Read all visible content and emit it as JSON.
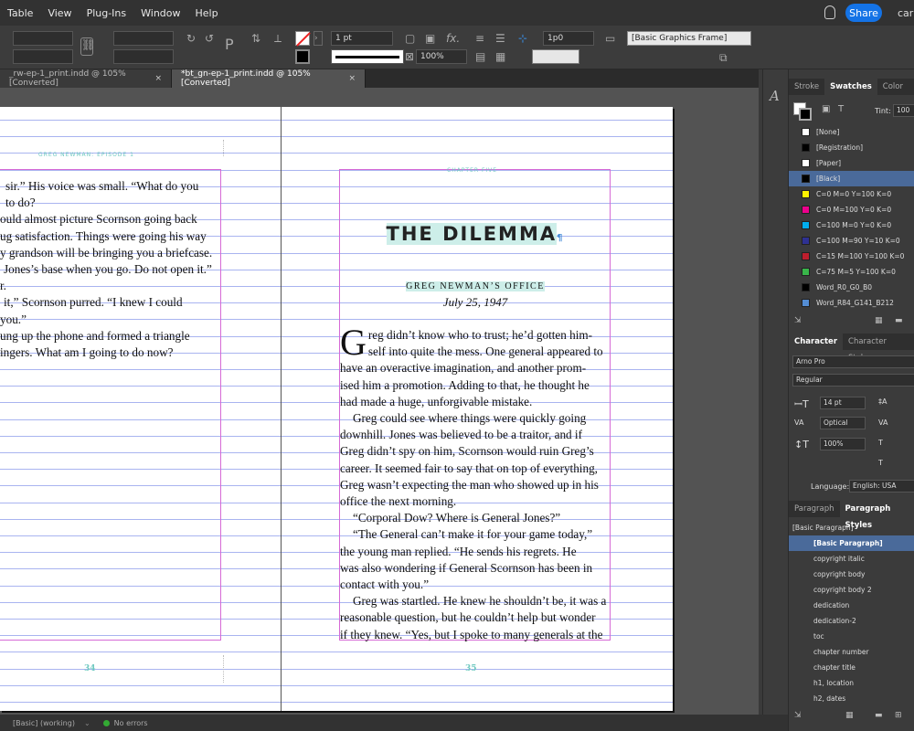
{
  "menu": {
    "items": [
      "Table",
      "View",
      "Plug-Ins",
      "Window",
      "Help"
    ],
    "share": "Share",
    "user": "car"
  },
  "control": {
    "stroke_weight": "1 pt",
    "scale": "100%",
    "offset": "1p0",
    "frame_style": "[Basic Graphics Frame]"
  },
  "tabs": [
    {
      "label": "_rw-ep-1_print.indd @ 105% [Converted]",
      "close": "×"
    },
    {
      "label": "*bt_gn-ep-1_print.indd @ 105% [Converted]",
      "close": "×"
    }
  ],
  "left_page": {
    "running_head": "GREG NEWMAN: EPISODE 1",
    "lines": [
      "sir.” His voice was small. “What do you",
      "to do?",
      "ould almost picture Scornson going back",
      "ug satisfaction. Things were going his way",
      "y grandson will be bringing you a briefcase.",
      "Jones’s base when you go. Do not open it.”",
      "r.",
      "it,” Scornson purred. “I knew I could",
      "you.”",
      "ung up the phone and formed a triangle",
      "ingers. What am I going to do now?"
    ],
    "folio": "34"
  },
  "right_page": {
    "chapter_label": "CHAPTER FIVE",
    "title": "THE DILEMMA",
    "subhead": "GREG NEWMAN’S OFFICE",
    "date": "July 25, 1947",
    "dropcap": "G",
    "lines": [
      "reg didn’t know who to trust; he’d gotten him-",
      "self into quite the mess. One general appeared to",
      "have an overactive imagination, and another prom-",
      "ised him a promotion. Adding to that, he thought he",
      "had made a huge, unforgivable mistake.",
      "Greg could see where things were quickly going",
      "downhill. Jones was believed to be a traitor, and if",
      "Greg didn’t spy on him, Scornson would ruin Greg’s",
      "career. It seemed fair to say that on top of everything,",
      "Greg wasn’t expecting the man who showed up in his",
      "office the next morning.",
      "“Corporal Dow? Where is General Jones?”",
      "“The General can’t make it for your game today,”",
      "the young man replied. “He sends his regrets. He",
      "was also wondering if General Scornson has been in",
      "contact with you.”",
      "Greg was startled. He knew he shouldn’t be, it was a",
      "reasonable question, but he couldn’t help but wonder",
      "if they knew. “Yes, but I spoke to many generals at the"
    ],
    "folio": "35"
  },
  "status": {
    "preflight_profile": "[Basic] (working)",
    "errors": "No errors"
  },
  "swatches_panel": {
    "tabs": [
      "Stroke",
      "Swatches",
      "Color"
    ],
    "tint_label": "Tint:",
    "tint_value": "100",
    "items": [
      {
        "name": "[None]",
        "color": "#ffffff"
      },
      {
        "name": "[Registration]",
        "color": "#000000"
      },
      {
        "name": "[Paper]",
        "color": "#ffffff"
      },
      {
        "name": "[Black]",
        "color": "#000000"
      },
      {
        "name": "C=0 M=0 Y=100 K=0",
        "color": "#fff200"
      },
      {
        "name": "C=0 M=100 Y=0 K=0",
        "color": "#ec008c"
      },
      {
        "name": "C=100 M=0 Y=0 K=0",
        "color": "#00aeef"
      },
      {
        "name": "C=100 M=90 Y=10 K=0",
        "color": "#2e3192"
      },
      {
        "name": "C=15 M=100 Y=100 K=0",
        "color": "#be1e2d"
      },
      {
        "name": "C=75 M=5 Y=100 K=0",
        "color": "#39b54a"
      },
      {
        "name": "Word_R0_G0_B0",
        "color": "#000000"
      },
      {
        "name": "Word_R84_G141_B212",
        "color": "#548dd4"
      }
    ]
  },
  "character_panel": {
    "tabs": [
      "Character",
      "Character Styles"
    ],
    "font": "Arno Pro",
    "style": "Regular",
    "size": "14 pt",
    "kerning": "Optical",
    "vscale": "100%",
    "language_label": "Language:",
    "language": "English: USA"
  },
  "paragraph_panel": {
    "tabs": [
      "Paragraph",
      "Paragraph Styles"
    ],
    "current": "[Basic Paragraph]",
    "styles": [
      "[Basic Paragraph]",
      "copyright italic",
      "copyright body",
      "copyright body 2",
      "dedication",
      "dedication-2",
      "toc",
      "chapter number",
      "chapter title",
      "h1, location",
      "h2, dates"
    ]
  }
}
